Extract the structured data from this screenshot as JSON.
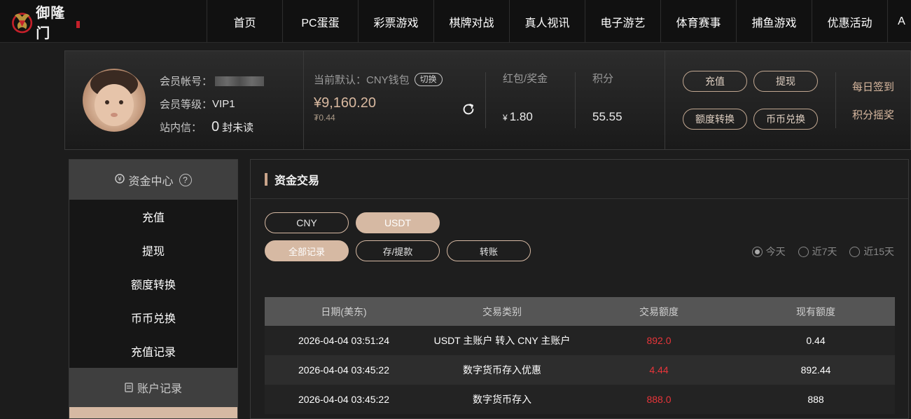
{
  "brand": {
    "name": "御隆门"
  },
  "nav": [
    "首页",
    "PC蛋蛋",
    "彩票游戏",
    "棋牌对战",
    "真人视讯",
    "电子游艺",
    "体育赛事",
    "捕鱼游戏",
    "优惠活动",
    "A"
  ],
  "user": {
    "account_label": "会员帐号：",
    "level_label": "会员等级：",
    "level_value": "VIP1",
    "inbox_label": "站内信：",
    "unread_count": "0",
    "unread_suffix": "封未读"
  },
  "wallet": {
    "label": "当前默认：CNY钱包",
    "switch_label": "切换",
    "amount": "¥9,160.20",
    "sub_amount": "₮0.44"
  },
  "stats": {
    "bonus_label": "红包/奖金",
    "bonus_currency": "¥",
    "bonus_value": "1.80",
    "points_label": "积分",
    "points_value": "55.55"
  },
  "actions": {
    "deposit": "充值",
    "withdraw": "提现",
    "transfer": "额度转换",
    "exchange": "币币兑换",
    "checkin": "每日签到",
    "lottery": "积分摇奖"
  },
  "sidebar": {
    "fund_center": "资金中心",
    "help": "?",
    "items": [
      "充值",
      "提现",
      "额度转换",
      "币币兑换",
      "充值记录"
    ],
    "account_records": "账户记录"
  },
  "main": {
    "title": "资金交易",
    "currency_tabs": [
      "CNY",
      "USDT"
    ],
    "filter_tabs": [
      "全部记录",
      "存/提款",
      "转账"
    ],
    "ranges": [
      "今天",
      "近7天",
      "近15天"
    ]
  },
  "table": {
    "headers": [
      "日期(美东)",
      "交易类别",
      "交易额度",
      "现有额度"
    ],
    "rows": [
      [
        "2026-04-04 03:51:24",
        "USDT 主账户 转入 CNY 主账户",
        "892.0",
        "0.44"
      ],
      [
        "2026-04-04 03:45:22",
        "数字货币存入优惠",
        "4.44",
        "892.44"
      ],
      [
        "2026-04-04 03:45:22",
        "数字货币存入",
        "888.0",
        "888"
      ]
    ]
  },
  "colors": {
    "accent": "#d6b9a3",
    "negative": "#e8353a"
  }
}
